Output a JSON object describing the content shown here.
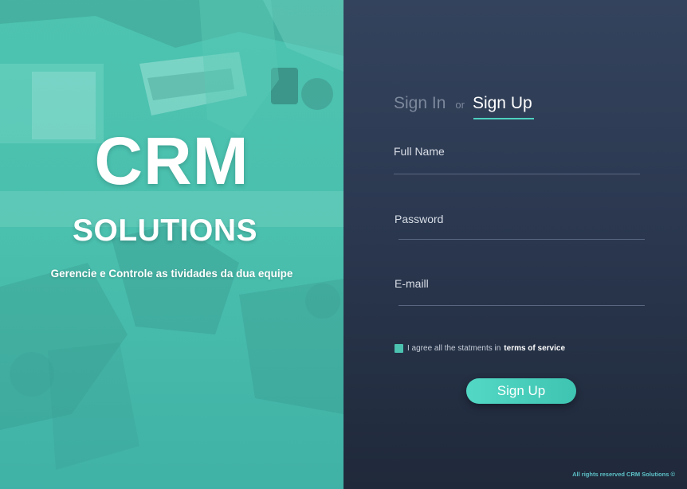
{
  "branding": {
    "title": "CRM",
    "subtitle": "SOLUTIONS",
    "tagline": "Gerencie e Controle as tividades da dua equipe"
  },
  "auth": {
    "tabs": {
      "signin": "Sign In",
      "or": "or",
      "signup": "Sign Up",
      "active": "signup"
    },
    "fields": {
      "full_name": {
        "label": "Full Name",
        "value": ""
      },
      "password": {
        "label": "Password",
        "value": ""
      },
      "email": {
        "label": "E-maill",
        "value": ""
      }
    },
    "agree": {
      "text": "I agree all the statments in",
      "link": "terms of service",
      "checked": true
    },
    "submit_label": "Sign Up"
  },
  "footer": {
    "text": "All rights reserved CRM Solutions ©"
  },
  "colors": {
    "accent": "#4dd0be",
    "panel_dark": "#26324a",
    "left_panel": "#47b7a8"
  }
}
